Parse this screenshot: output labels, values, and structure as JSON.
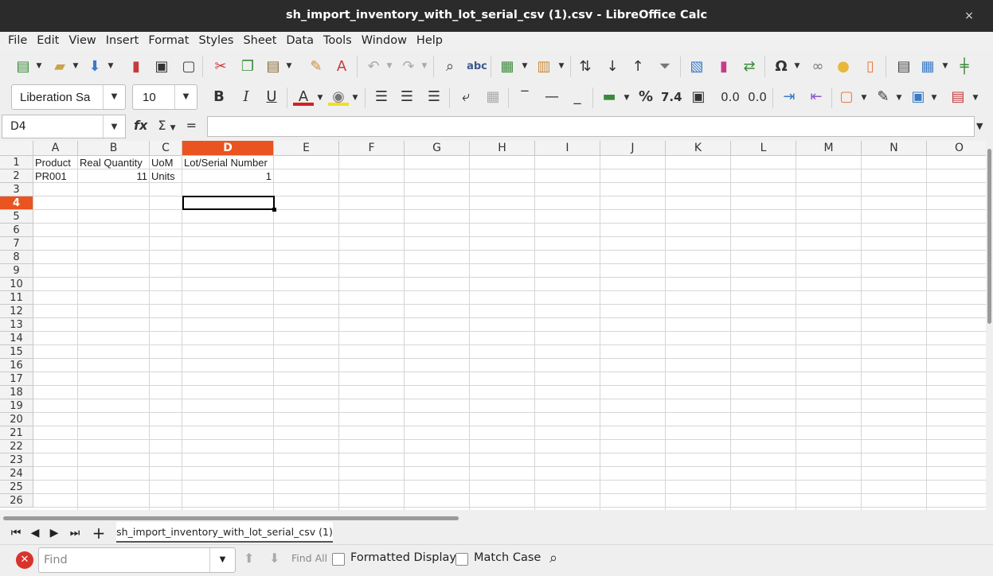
{
  "window": {
    "title": "sh_import_inventory_with_lot_serial_csv (1).csv - LibreOffice Calc",
    "close_glyph": "×"
  },
  "menu": [
    "File",
    "Edit",
    "View",
    "Insert",
    "Format",
    "Styles",
    "Sheet",
    "Data",
    "Tools",
    "Window",
    "Help"
  ],
  "formatting": {
    "font_name": "Liberation Sa",
    "font_size": "10"
  },
  "formula_bar": {
    "cell_ref": "D4",
    "content": ""
  },
  "columns": [
    "A",
    "B",
    "C",
    "D",
    "E",
    "F",
    "G",
    "H",
    "I",
    "J",
    "K",
    "L",
    "M",
    "N",
    "O"
  ],
  "rows": [
    "1",
    "2",
    "3",
    "4",
    "5",
    "6",
    "7",
    "8",
    "9",
    "10",
    "11",
    "12",
    "13",
    "14",
    "15",
    "16",
    "17",
    "18",
    "19",
    "20",
    "21",
    "22",
    "23",
    "24",
    "25",
    "26"
  ],
  "cells": {
    "A1": "Product",
    "B1": "Real Quantity",
    "C1": "UoM",
    "D1": "Lot/Serial Number",
    "A2": "PR001",
    "B2": "11",
    "C2": "Units",
    "D2": "1"
  },
  "active_cell": {
    "col": "D",
    "row": "4"
  },
  "sheet_tabs": [
    "sh_import_inventory_with_lot_serial_csv (1)"
  ],
  "find_bar": {
    "placeholder": "Find",
    "find_all_label": "Find All",
    "formatted_display_label": "Formatted Display",
    "match_case_label": "Match Case"
  },
  "icons": [
    "new-document",
    "open",
    "save",
    "export-pdf",
    "print",
    "print-preview",
    "cut",
    "copy",
    "paste",
    "clone-formatting",
    "clear-formatting",
    "undo",
    "redo",
    "find-replace",
    "spelling",
    "row",
    "column",
    "sort",
    "sort-ascending",
    "sort-descending",
    "autofilter",
    "image",
    "chart",
    "pivot-table",
    "special-character",
    "hyperlink",
    "comment",
    "headers-footers",
    "define-print-area",
    "freeze",
    "split-window",
    "bold",
    "italic",
    "underline",
    "font-color",
    "highlight",
    "align-left",
    "align-center",
    "align-right",
    "wrap-text",
    "merge-center",
    "align-top",
    "align-middle",
    "align-bottom",
    "currency",
    "percent",
    "number",
    "date",
    "add-decimal",
    "delete-decimal",
    "increase-indent",
    "decrease-indent",
    "borders",
    "border-style",
    "border-color",
    "conditional"
  ]
}
